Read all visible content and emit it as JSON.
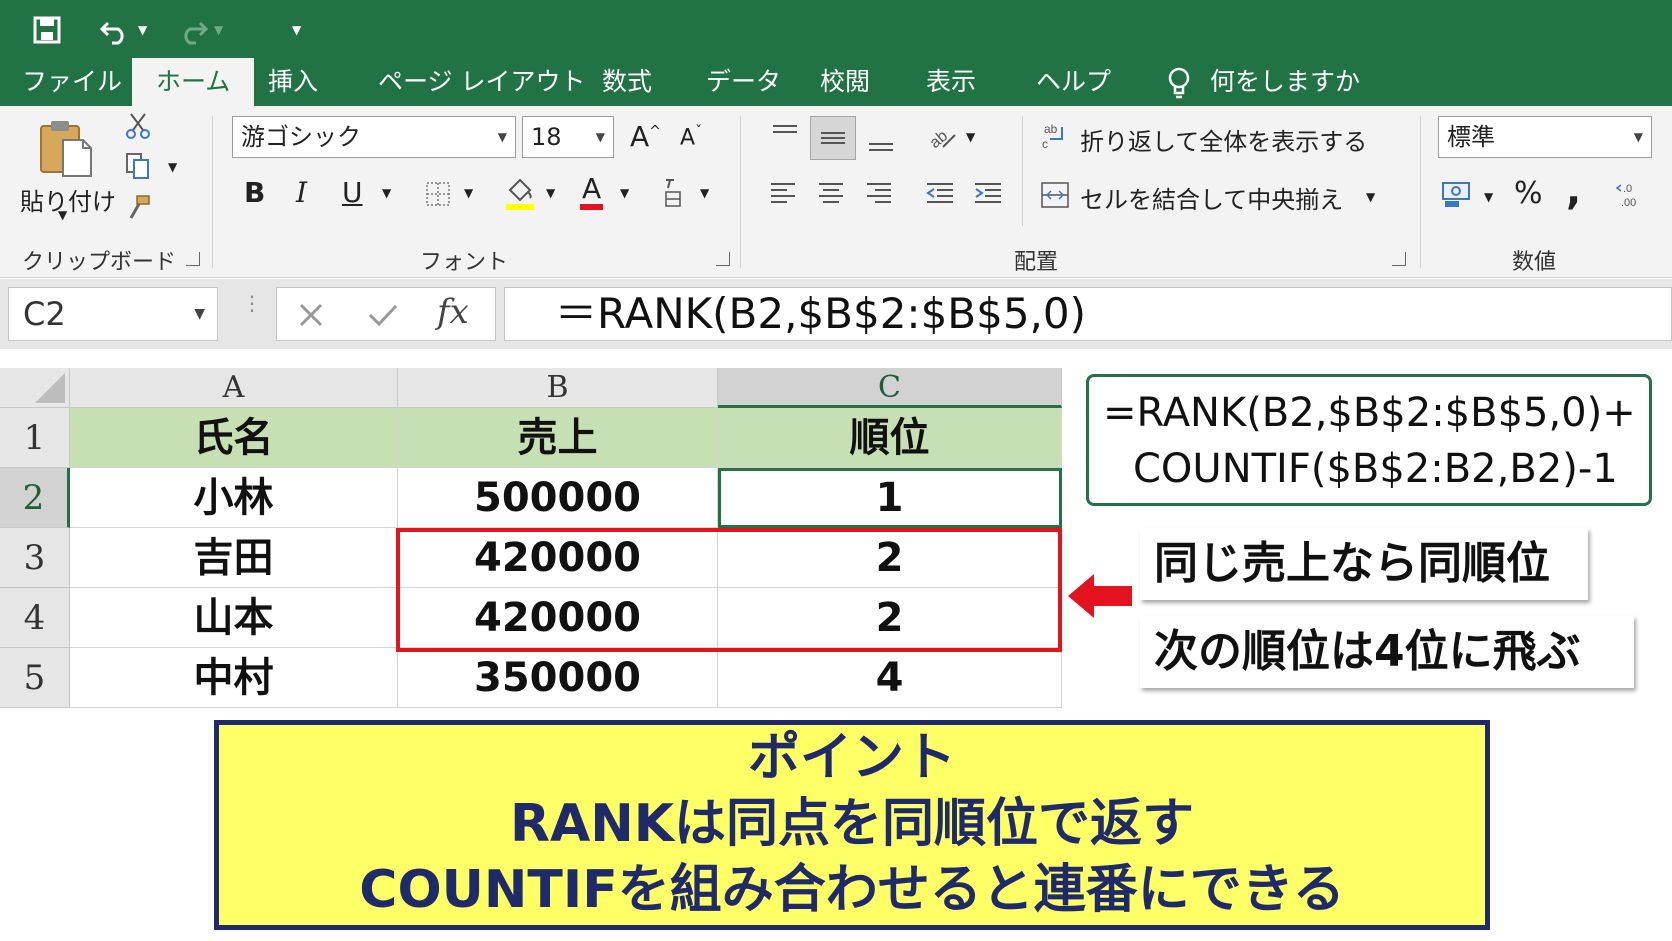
{
  "ribbon_tabs": [
    "ファイル",
    "ホーム",
    "挿入",
    "ページ レイアウト",
    "数式",
    "データ",
    "校閲",
    "表示",
    "ヘルプ"
  ],
  "tell_me": "何をしますか",
  "clipboard": {
    "paste": "貼り付け",
    "label": "クリップボード"
  },
  "font": {
    "name": "游ゴシック",
    "size": "18",
    "label": "フォント",
    "bold": "B",
    "italic": "I",
    "underline": "U",
    "font_color": "A",
    "grow": "A",
    "shrink": "A"
  },
  "alignment": {
    "wrap_text": "折り返して全体を表示する",
    "merge_center": "セルを結合して中央揃え",
    "label": "配置"
  },
  "number": {
    "format": "標準",
    "label": "数値",
    "percent": "%",
    "comma": ","
  },
  "formula_bar": {
    "name_box": "C2",
    "fx": "fx",
    "formula": "＝RANK(B2,$B$2:$B$5,0)"
  },
  "columns": [
    "A",
    "B",
    "C"
  ],
  "rows": [
    "1",
    "2",
    "3",
    "4",
    "5"
  ],
  "table": {
    "header": [
      "氏名",
      "売上",
      "順位"
    ],
    "data": [
      [
        "小林",
        "500000",
        "1"
      ],
      [
        "吉田",
        "420000",
        "2"
      ],
      [
        "山本",
        "420000",
        "2"
      ],
      [
        "中村",
        "350000",
        "4"
      ]
    ]
  },
  "annotations": {
    "formula_line1": "=RANK(B2,$B$2:$B$5,0)+",
    "formula_line2": "COUNTIF($B$2:B2,B2)-1",
    "note1": "同じ売上なら同順位",
    "note2": "次の順位は4位に飛ぶ"
  },
  "point_box": {
    "title": "ポイント",
    "line1": "RANKは同点を同順位で返す",
    "line2": "COUNTIFを組み合わせると連番にできる"
  },
  "colors": {
    "excel_green": "#217346",
    "header_fill": "#c6e0b4",
    "highlight_red": "#e3141f",
    "point_fill": "#ffff66",
    "point_border": "#1f2a6b"
  }
}
